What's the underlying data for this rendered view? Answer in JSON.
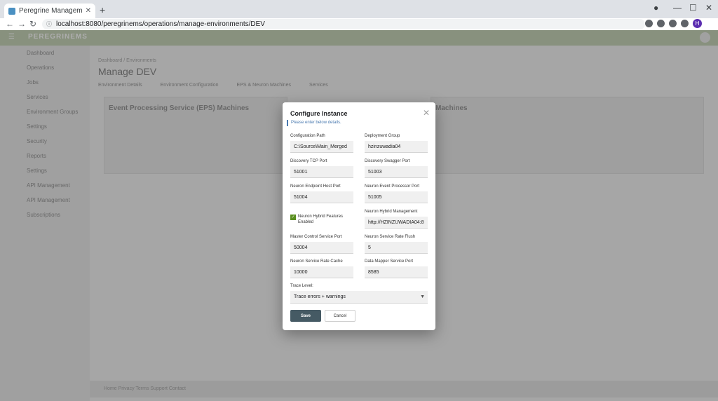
{
  "browser": {
    "tab_title": "Peregrine Management Portal",
    "url": "localhost:8080/peregrinems/operations/manage-environments/DEV",
    "profile_initial": "H"
  },
  "app": {
    "brand": "PEREGRINEMS",
    "breadcrumb": "Dashboard / Environments",
    "page_title": "Manage DEV",
    "tabs": [
      "Environment Details",
      "Environment Configuration",
      "EPS & Neuron Machines",
      "Services"
    ],
    "sidebar": [
      "Dashboard",
      "Operations",
      "Jobs",
      "Services",
      "Environment Groups",
      "Settings",
      "Security",
      "Reports",
      "Settings",
      "API Management",
      "API Management",
      "Subscriptions"
    ],
    "left_panel_title": "Event Processing Service (EPS) Machines",
    "right_panel_title": "Machines",
    "footer_text": "Home  Privacy  Terms  Support  Contact"
  },
  "dialog": {
    "title": "Configure Instance",
    "subtitle": "Please enter below details.",
    "fields": {
      "configuration_path": {
        "label": "Configuration Path",
        "value": "C:\\Source\\Main_Merged"
      },
      "deployment_group": {
        "label": "Deployment Group",
        "value": "hzinzuwadia04"
      },
      "discovery_tcp_port": {
        "label": "Discovery TCP Port",
        "value": "51001"
      },
      "discovery_swagger_port": {
        "label": "Discovery Swagger Port",
        "value": "51003"
      },
      "neuron_endpoint_host_port": {
        "label": "Neuron Endpoint Host Port",
        "value": "51004"
      },
      "neuron_event_processor_port": {
        "label": "Neuron Event Processor Port",
        "value": "51005"
      },
      "neuron_hybrid_management": {
        "label": "Neuron Hybrid Management",
        "value": "http://HZINZUWADIA04:8"
      },
      "master_control_service_port": {
        "label": "Master Control Service Port",
        "value": "50004"
      },
      "neuron_service_rate_flush": {
        "label": "Neuron Service Rate Flush",
        "value": "5"
      },
      "neuron_service_rate_cache": {
        "label": "Neuron Service Rate Cache",
        "value": "10000"
      },
      "data_mapper_service_port": {
        "label": "Data Mapper Service Port",
        "value": "8585"
      }
    },
    "hybrid_checkbox": {
      "label": "Neuron Hybrid Features Enabled",
      "checked": true
    },
    "trace_level": {
      "label": "Trace Level:",
      "value": "Trace errors + warnings"
    },
    "save_label": "Save",
    "cancel_label": "Cancel"
  },
  "colors": {
    "appbar": "#c9d6ba",
    "save_button": "#455a64",
    "checkbox": "#5a8f1f",
    "accent": "#4a7ab0"
  }
}
